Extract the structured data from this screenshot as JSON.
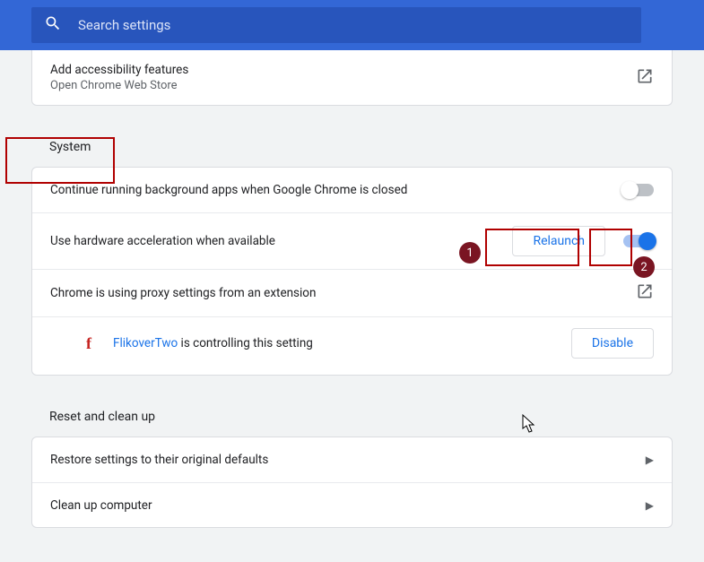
{
  "search": {
    "placeholder": "Search settings"
  },
  "accessibility": {
    "title": "Add accessibility features",
    "subtitle": "Open Chrome Web Store"
  },
  "sections": {
    "system": "System",
    "reset": "Reset and clean up"
  },
  "system": {
    "bgApps": "Continue running background apps when Google Chrome is closed",
    "hwAccel": "Use hardware acceleration when available",
    "relaunch": "Relaunch",
    "proxy": "Chrome is using proxy settings from an extension",
    "extensionName": "FlikoverTwo",
    "extensionSuffix": " is controlling this setting",
    "disable": "Disable"
  },
  "reset": {
    "restore": "Restore settings to their original defaults",
    "cleanup": "Clean up computer"
  },
  "annotations": {
    "one": "1",
    "two": "2"
  }
}
